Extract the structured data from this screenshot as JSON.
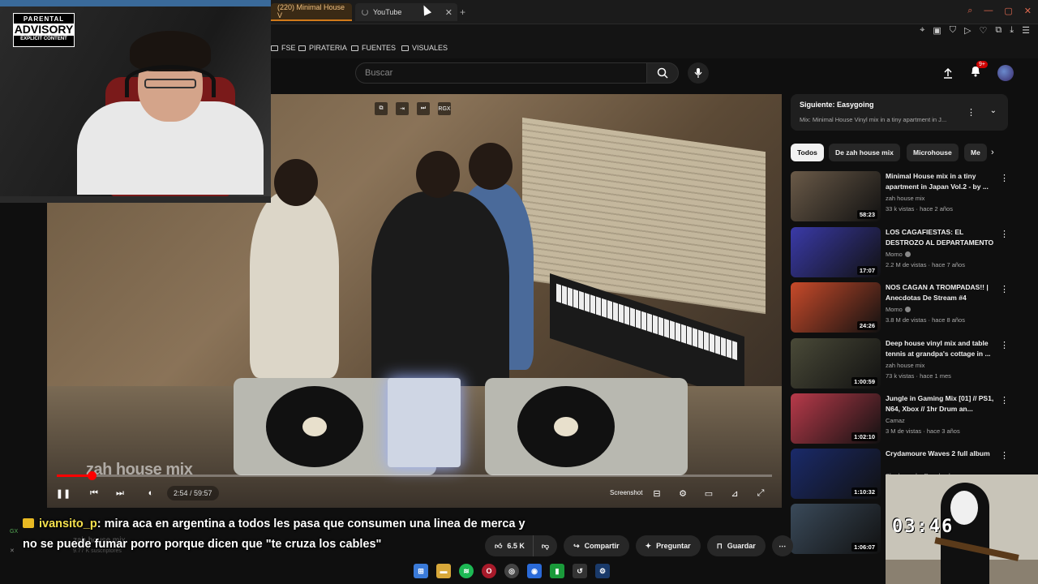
{
  "browser": {
    "tabs": [
      {
        "label": "(220) Minimal House V"
      },
      {
        "label": "YouTube"
      }
    ],
    "bookmarks": [
      {
        "label": "FSE"
      },
      {
        "label": "PIRATERIA"
      },
      {
        "label": "FUENTES"
      },
      {
        "label": "VISUALES"
      }
    ]
  },
  "header": {
    "search_placeholder": "Buscar",
    "notifications_badge": "9+"
  },
  "webcam": {
    "advisory_top": "PARENTAL",
    "advisory_mid": "ADVISORY",
    "advisory_bottom": "EXPLICIT CONTENT"
  },
  "player": {
    "watermark": "zah house mix",
    "time": "2:54 / 59:57",
    "progress": 0.0486,
    "overlay_label": "RGX",
    "screenshot_label": "Screenshot"
  },
  "upnext": {
    "title": "Siguiente: Easygoing",
    "subtitle": "Mix: Minimal House Vinyl mix in a tiny apartment in J..."
  },
  "chips": [
    "Todos",
    "De zah house mix",
    "Microhouse",
    "Me"
  ],
  "recommendations": [
    {
      "title": "Minimal House mix in a tiny apartment in Japan Vol.2 - by ...",
      "channel": "zah house mix",
      "meta": "33 k vistas · hace 2 años",
      "duration": "58:23",
      "verified": false,
      "color": "#6a5a48"
    },
    {
      "title": "LOS CAGAFIESTAS: EL DESTROZO AL DEPARTAMENTO",
      "channel": "Momo",
      "meta": "2.2 M de vistas · hace 7 años",
      "duration": "17:07",
      "verified": true,
      "color": "#3a3aa8"
    },
    {
      "title": "NOS CAGAN A TROMPADAS!! | Anecdotas De Stream #4",
      "channel": "Momo",
      "meta": "3.8 M de vistas · hace 8 años",
      "duration": "24:26",
      "verified": true,
      "color": "#c84a2a"
    },
    {
      "title": "Deep house vinyl mix and table tennis at grandpa's cottage in ...",
      "channel": "zah house mix",
      "meta": "73 k vistas · hace 1 mes",
      "duration": "1:00:59",
      "verified": false,
      "color": "#4a4a38"
    },
    {
      "title": "Jungle in Gaming Mix [01] // PS1, N64, Xbox // 1hr Drum an...",
      "channel": "Camaz",
      "meta": "3 M de vistas · hace 3 años",
      "duration": "1:02:10",
      "verified": false,
      "color": "#b83a4a"
    },
    {
      "title": "Crydamoure Waves 2 full album",
      "channel": "Shadermader Reuploads",
      "meta": "",
      "duration": "1:10:32",
      "verified": false,
      "color": "#1a2a6a"
    },
    {
      "title": "",
      "channel": "",
      "meta": "",
      "duration": "1:06:07",
      "verified": false,
      "color": "#3a4a5a"
    }
  ],
  "actions": {
    "likes": "6.5 K",
    "share": "Compartir",
    "ask": "Preguntar",
    "save": "Guardar"
  },
  "channel_ghost": {
    "name": "zah house mix",
    "subs": "9.77 K suscriptores"
  },
  "chat": {
    "user": "ivansito_p",
    "message": ": mira aca en argentina a todos les pasa que consumen una linea de merca y no se puede fumar porro porque dicen que \"te cruza los cables\""
  },
  "corner_timer": "03:46"
}
